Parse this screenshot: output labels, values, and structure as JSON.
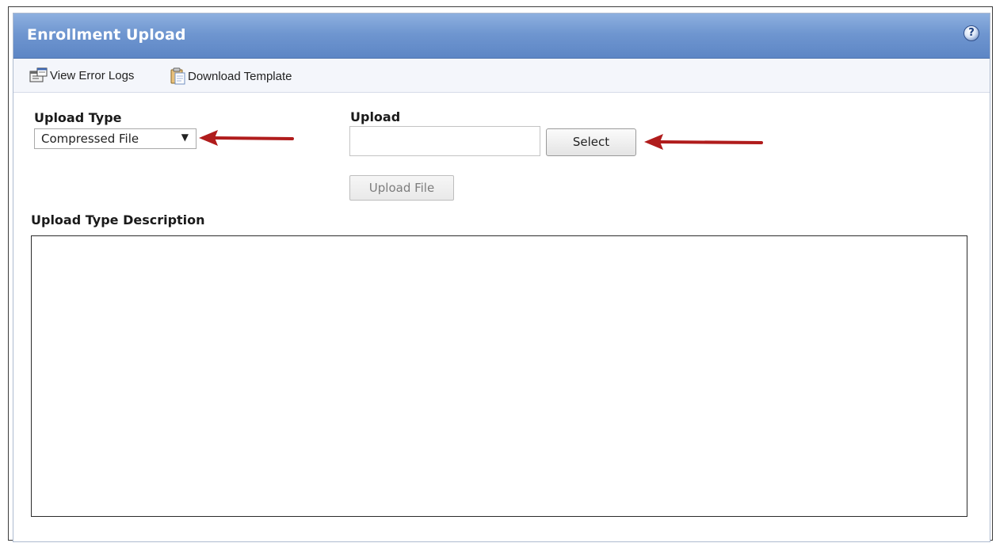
{
  "panel": {
    "title": "Enrollment Upload",
    "help_icon": "question-circle-icon",
    "help_glyph": "?"
  },
  "toolbar": {
    "view_error_logs": "View Error Logs",
    "view_error_logs_icon": "log-window-icon",
    "download_template": "Download Template",
    "download_template_icon": "clipboard-icon"
  },
  "form": {
    "upload_type_label": "Upload Type",
    "upload_type_value": "Compressed File",
    "dropdown_glyph": "▼",
    "upload_label": "Upload",
    "file_value": "",
    "select_button": "Select",
    "upload_file_button": "Upload File",
    "upload_file_disabled": true,
    "description_label": "Upload Type Description",
    "description_value": ""
  },
  "annotations": {
    "arrow_color": "#b01c1c",
    "arrow_count": 2
  },
  "colors": {
    "title_bar": "#6f96d0",
    "title_text": "#ffffff",
    "toolbar_bg": "#f4f6fb"
  }
}
